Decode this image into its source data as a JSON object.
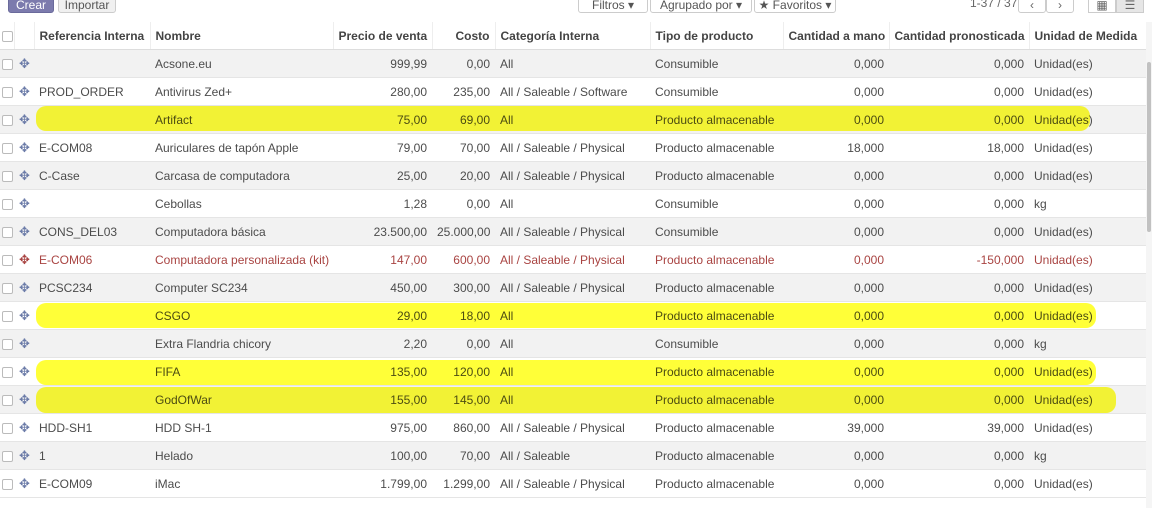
{
  "toolbar": {
    "create_label": "Crear",
    "import_label": "Importar",
    "filters_label": "Filtros ▾",
    "groupby_label": "Agrupado por ▾",
    "favorites_label": "★ Favoritos ▾",
    "pager": "1-37 / 37"
  },
  "columns": [
    "Referencia Interna",
    "Nombre",
    "Precio de venta",
    "Costo",
    "Categoría Interna",
    "Tipo de producto",
    "Cantidad a mano",
    "Cantidad pronosticada",
    "Unidad de Medida"
  ],
  "rows": [
    {
      "ref": "",
      "name": "Acsone.eu",
      "price": "999,99",
      "cost": "0,00",
      "category": "All",
      "type": "Consumible",
      "onhand": "0,000",
      "forecast": "0,000",
      "uom": "Unidad(es)"
    },
    {
      "ref": "PROD_ORDER",
      "name": "Antivirus Zed+",
      "price": "280,00",
      "cost": "235,00",
      "category": "All / Saleable / Software",
      "type": "Consumible",
      "onhand": "0,000",
      "forecast": "0,000",
      "uom": "Unidad(es)"
    },
    {
      "ref": "",
      "name": "Artifact",
      "price": "75,00",
      "cost": "69,00",
      "category": "All",
      "type": "Producto almacenable",
      "onhand": "0,000",
      "forecast": "0,000",
      "uom": "Unidad(es)"
    },
    {
      "ref": "E-COM08",
      "name": "Auriculares de tapón Apple",
      "price": "79,00",
      "cost": "70,00",
      "category": "All / Saleable / Physical",
      "type": "Producto almacenable",
      "onhand": "18,000",
      "forecast": "18,000",
      "uom": "Unidad(es)"
    },
    {
      "ref": "C-Case",
      "name": "Carcasa de computadora",
      "price": "25,00",
      "cost": "20,00",
      "category": "All / Saleable / Physical",
      "type": "Producto almacenable",
      "onhand": "0,000",
      "forecast": "0,000",
      "uom": "Unidad(es)"
    },
    {
      "ref": "",
      "name": "Cebollas",
      "price": "1,28",
      "cost": "0,00",
      "category": "All",
      "type": "Consumible",
      "onhand": "0,000",
      "forecast": "0,000",
      "uom": "kg"
    },
    {
      "ref": "CONS_DEL03",
      "name": "Computadora básica",
      "price": "23.500,00",
      "cost": "25.000,00",
      "category": "All / Saleable / Physical",
      "type": "Consumible",
      "onhand": "0,000",
      "forecast": "0,000",
      "uom": "Unidad(es)"
    },
    {
      "ref": "E-COM06",
      "name": "Computadora personalizada (kit)",
      "price": "147,00",
      "cost": "600,00",
      "category": "All / Saleable / Physical",
      "type": "Producto almacenable",
      "onhand": "0,000",
      "forecast": "-150,000",
      "uom": "Unidad(es)",
      "danger": true
    },
    {
      "ref": "PCSC234",
      "name": "Computer SC234",
      "price": "450,00",
      "cost": "300,00",
      "category": "All / Saleable / Physical",
      "type": "Producto almacenable",
      "onhand": "0,000",
      "forecast": "0,000",
      "uom": "Unidad(es)"
    },
    {
      "ref": "",
      "name": "CSGO",
      "price": "29,00",
      "cost": "18,00",
      "category": "All",
      "type": "Producto almacenable",
      "onhand": "0,000",
      "forecast": "0,000",
      "uom": "Unidad(es)"
    },
    {
      "ref": "",
      "name": "Extra Flandria chicory",
      "price": "2,20",
      "cost": "0,00",
      "category": "All",
      "type": "Consumible",
      "onhand": "0,000",
      "forecast": "0,000",
      "uom": "kg"
    },
    {
      "ref": "",
      "name": "FIFA",
      "price": "135,00",
      "cost": "120,00",
      "category": "All",
      "type": "Producto almacenable",
      "onhand": "0,000",
      "forecast": "0,000",
      "uom": "Unidad(es)"
    },
    {
      "ref": "",
      "name": "GodOfWar",
      "price": "155,00",
      "cost": "145,00",
      "category": "All",
      "type": "Producto almacenable",
      "onhand": "0,000",
      "forecast": "0,000",
      "uom": "Unidad(es)"
    },
    {
      "ref": "HDD-SH1",
      "name": "HDD SH-1",
      "price": "975,00",
      "cost": "860,00",
      "category": "All / Saleable / Physical",
      "type": "Producto almacenable",
      "onhand": "39,000",
      "forecast": "39,000",
      "uom": "Unidad(es)"
    },
    {
      "ref": "1",
      "name": "Helado",
      "price": "100,00",
      "cost": "70,00",
      "category": "All / Saleable",
      "type": "Producto almacenable",
      "onhand": "0,000",
      "forecast": "0,000",
      "uom": "kg"
    },
    {
      "ref": "E-COM09",
      "name": "iMac",
      "price": "1.799,00",
      "cost": "1.299,00",
      "category": "All / Saleable / Physical",
      "type": "Producto almacenable",
      "onhand": "0,000",
      "forecast": "0,000",
      "uom": "Unidad(es)"
    }
  ]
}
